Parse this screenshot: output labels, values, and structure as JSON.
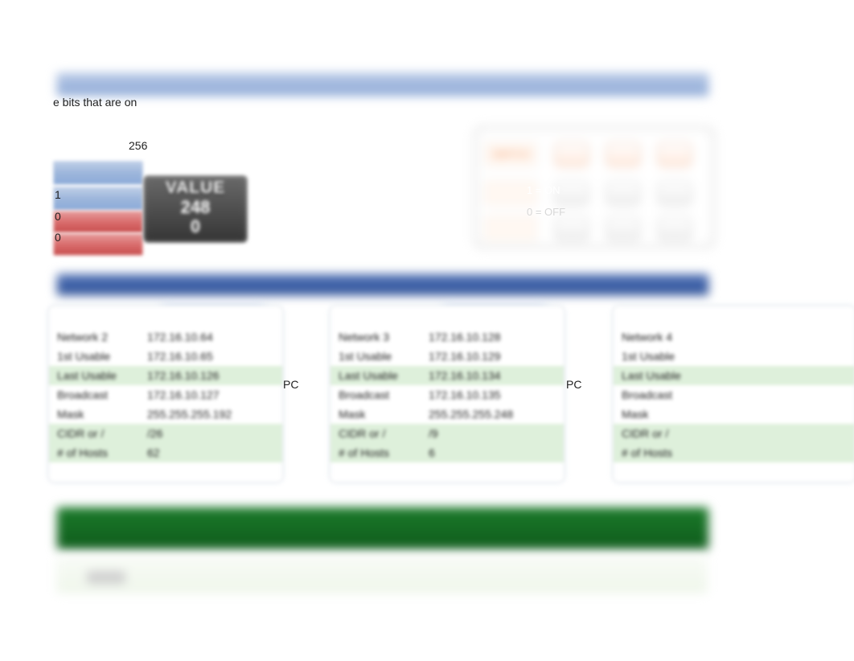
{
  "intro_tail": "e bits that are on",
  "num_256": "256",
  "switch_small": {
    "row1": "1",
    "row2": "0",
    "row3": "0"
  },
  "value_box": {
    "title": "VALUE",
    "v1": "248",
    "v2": "0"
  },
  "rswitch": {
    "kw_switch": "SWITCH",
    "kw_on": "1 = ON",
    "kw_off": "0 = OFF",
    "top_nums": [
      "1",
      "2",
      "3"
    ],
    "on_vals": [
      "128",
      "64",
      "32"
    ],
    "off_vals": [
      "-",
      "-",
      "-"
    ]
  },
  "cards": [
    {
      "idx": "2",
      "rows": {
        "network_k": "Network 2",
        "network_v": "172.16.10.64",
        "first_k": "1st Usable",
        "first_v": "172.16.10.65",
        "last_k": "Last Usable",
        "last_v": "172.16.10.126",
        "bcast_k": "Broadcast",
        "bcast_v": "172.16.10.127",
        "mask_k": "Mask",
        "mask_v": "255.255.255.192",
        "cidr_k": "CIDR or /",
        "cidr_v": "/26",
        "hosts_k": "# of Hosts",
        "hosts_v": "62"
      }
    },
    {
      "idx": "3",
      "rows": {
        "network_k": "Network 3",
        "network_v": "172.16.10.128",
        "first_k": "1st Usable",
        "first_v": "172.16.10.129",
        "last_k": "Last Usable",
        "last_v": "172.16.10.134",
        "bcast_k": "Broadcast",
        "bcast_v": "172.16.10.135",
        "mask_k": "Mask",
        "mask_v": "255.255.255.248",
        "cidr_k": "CIDR or /",
        "cidr_v": "/9",
        "hosts_k": "# of Hosts",
        "hosts_v": "6"
      }
    },
    {
      "idx": "4",
      "rows": {
        "network_k": "Network 4",
        "network_v": "",
        "first_k": "1st Usable",
        "first_v": "",
        "last_k": "Last Usable",
        "last_v": "",
        "bcast_k": "Broadcast",
        "bcast_v": "",
        "mask_k": "Mask",
        "mask_v": "",
        "cidr_k": "CIDR or /",
        "cidr_v": "",
        "hosts_k": "# of Hosts",
        "hosts_v": ""
      }
    }
  ],
  "pc_label": "PC"
}
